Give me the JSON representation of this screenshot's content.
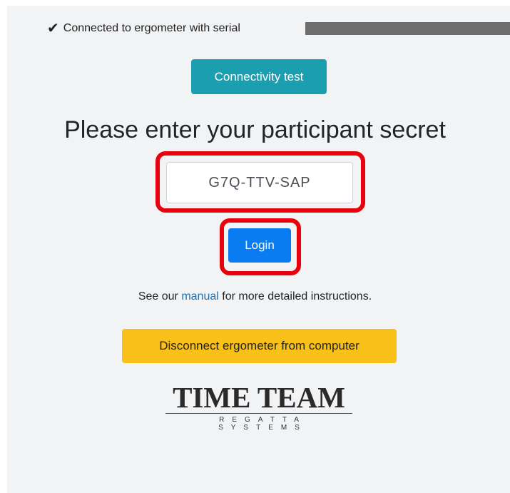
{
  "status": {
    "icon": "check-icon",
    "text": "Connected to ergometer with serial"
  },
  "buttons": {
    "connectivity_test": "Connectivity test",
    "login": "Login",
    "disconnect": "Disconnect ergometer from computer"
  },
  "heading": "Please enter your participant secret",
  "secret_input": {
    "value": "G7Q-TTV-SAP"
  },
  "manual_line": {
    "prefix": "See our ",
    "link": "manual",
    "suffix": " for more detailed instructions."
  },
  "logo": {
    "main": "TIME TEAM",
    "sub": "REGATTA SYSTEMS"
  },
  "colors": {
    "highlight": "#e8000b",
    "connectivity_button": "#1b9fb0",
    "login_button": "#0a7bf0",
    "disconnect_button": "#f8c018",
    "link": "#1a6fb8"
  }
}
